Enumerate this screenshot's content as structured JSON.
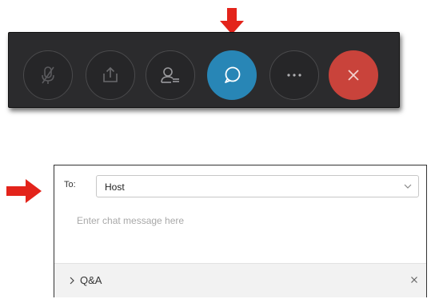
{
  "colors": {
    "toolbar_bg": "#2b2b2d",
    "chat_accent": "#2886b6",
    "end_red": "#c9433b",
    "arrow_red": "#e3241b"
  },
  "toolbar": {
    "buttons": [
      {
        "name": "mute-button",
        "icon": "microphone-muted-icon"
      },
      {
        "name": "share-button",
        "icon": "share-icon"
      },
      {
        "name": "participants-button",
        "icon": "participants-icon"
      },
      {
        "name": "chat-button",
        "icon": "chat-bubble-icon",
        "active": true
      },
      {
        "name": "more-button",
        "icon": "more-options-icon",
        "label": "···"
      },
      {
        "name": "end-button",
        "icon": "close-icon"
      }
    ]
  },
  "chat_panel": {
    "to_label": "To:",
    "recipient": "Host",
    "placeholder": "Enter chat message here",
    "qa_label": "Q&A",
    "qa_close": "×"
  }
}
